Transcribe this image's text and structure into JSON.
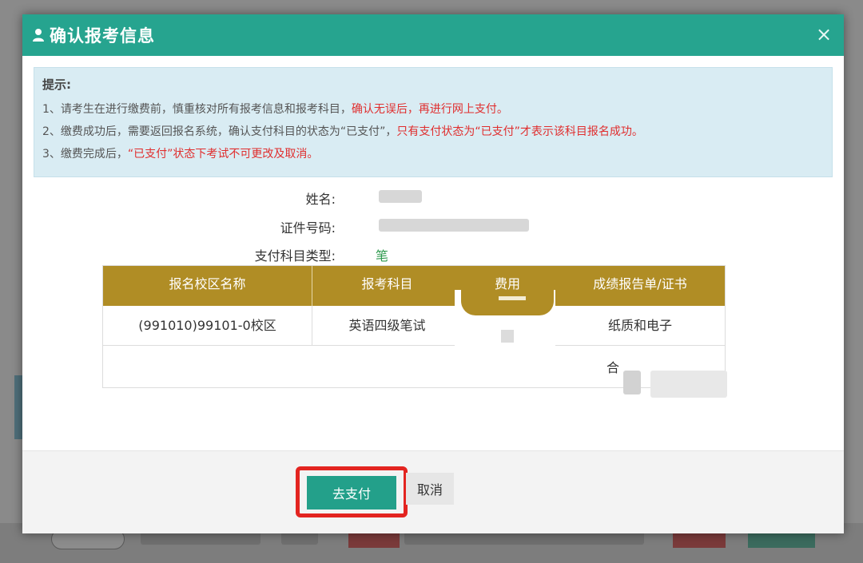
{
  "modal": {
    "title": "确认报考信息",
    "close_glyph": "×"
  },
  "tips": {
    "title": "提示:",
    "line1_normal": "1、请考生在进行缴费前，慎重核对所有报考信息和报考科目，",
    "line1_red": "确认无误后，再进行网上支付。",
    "line2_normal_a": "2、缴费成功后，需要返回报名系统，确认支付科目的状态为“已支付”，",
    "line2_red": "只有支付状态为“已支付”才表示该科目报名成功。",
    "line3_normal": "3、缴费完成后，",
    "line3_red": "“已支付”状态下考试不可更改及取消。"
  },
  "info": {
    "name_label": "姓名:",
    "id_label": "证件号码:",
    "subject_type_label": "支付科目类型:",
    "subject_type_value": "笔试"
  },
  "table": {
    "headers": [
      "报名校区名称",
      "报考科目",
      "费用",
      "成绩报告单/证书"
    ],
    "row": {
      "campus": "(991010)99101-0校区",
      "subject": "英语四级笔试",
      "certificate": "纸质和电子"
    },
    "total_label": "合"
  },
  "footer": {
    "pay_label": "去支付",
    "cancel_label": "取消"
  },
  "colors": {
    "header": "#26a48f",
    "table_head": "#b08d25",
    "tip_red": "#e02e2e",
    "highlight": "#e32420"
  }
}
